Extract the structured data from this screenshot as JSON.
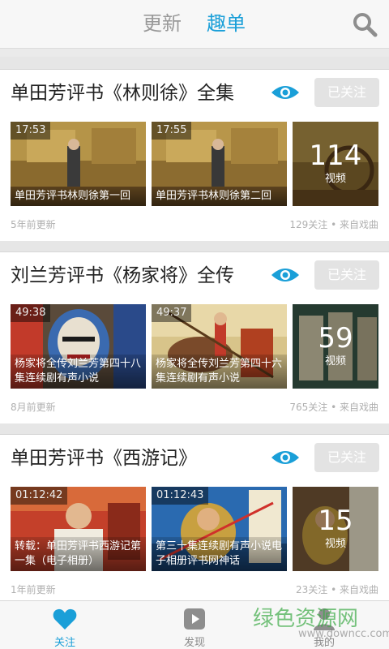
{
  "header": {
    "tabs": [
      {
        "label": "更新",
        "active": false
      },
      {
        "label": "趣单",
        "active": true
      }
    ],
    "search_icon": "search-icon"
  },
  "colors": {
    "accent": "#1a9fd8",
    "follow_button_bg": "#e3e3e3",
    "meta_text": "#b0b0b0"
  },
  "cards": [
    {
      "title": "单田芳评书《林则徐》全集",
      "follow_label": "已关注",
      "videos": [
        {
          "duration": "17:53",
          "caption": "单田芳评书林则徐第一回"
        },
        {
          "duration": "17:55",
          "caption": "单田芳评书林则徐第二回"
        }
      ],
      "count": "114",
      "count_unit": "视频",
      "updated": "5年前更新",
      "stats": "129关注 • 来自戏曲"
    },
    {
      "title": "刘兰芳评书《杨家将》全传",
      "follow_label": "已关注",
      "videos": [
        {
          "duration": "49:38",
          "caption": "杨家将全传刘兰芳第四十八集连续剧有声小说"
        },
        {
          "duration": "49:37",
          "caption": "杨家将全传刘兰芳第四十六集连续剧有声小说"
        }
      ],
      "count": "59",
      "count_unit": "视频",
      "updated": "8月前更新",
      "stats": "765关注 • 来自戏曲"
    },
    {
      "title": "单田芳评书《西游记》",
      "follow_label": "已关注",
      "videos": [
        {
          "duration": "01:12:42",
          "caption": "转载：单田芳评书西游记第一集（电子相册）"
        },
        {
          "duration": "01:12:43",
          "caption": "第三十集连续剧有声小说电子相册评书网神话"
        }
      ],
      "count": "15",
      "count_unit": "视频",
      "updated": "1年前更新",
      "stats": "23关注 • 来自戏曲"
    }
  ],
  "bottom_nav": [
    {
      "label": "关注",
      "icon": "heart-icon",
      "active": true
    },
    {
      "label": "发现",
      "icon": "play-icon",
      "active": false
    },
    {
      "label": "我的",
      "icon": "person-icon",
      "active": false
    }
  ],
  "watermark": {
    "text": "绿色资源网",
    "sub": "www.downcc.com"
  }
}
